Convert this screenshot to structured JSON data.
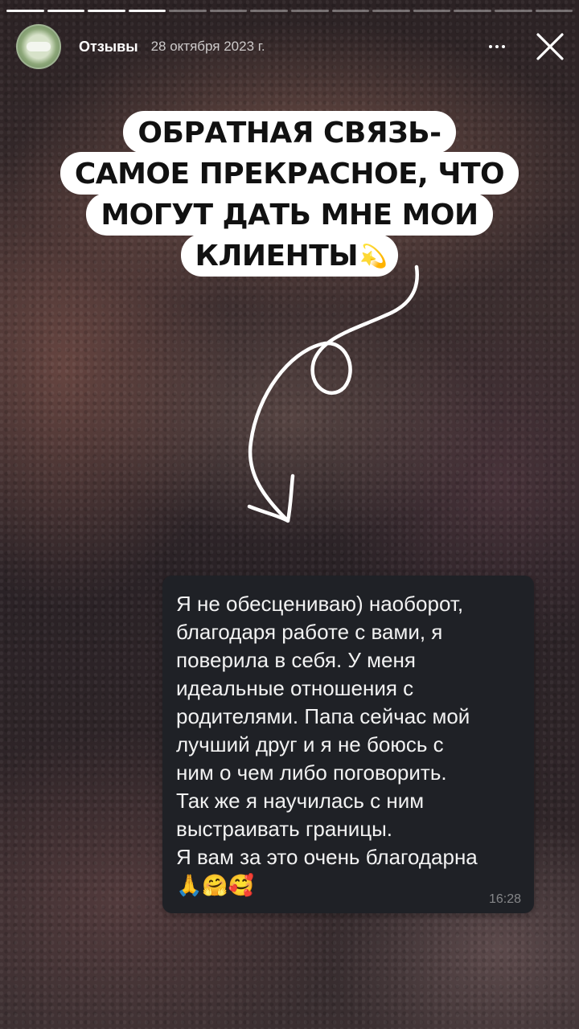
{
  "story": {
    "progress": {
      "segments_total": 14,
      "segments_done": 4
    },
    "header": {
      "account_name": "Отзывы",
      "date": "28 октября 2023 г.",
      "more_icon": "more-dots-icon",
      "close_icon": "close-icon"
    },
    "sticker": {
      "lines": [
        "ОБРАТНАЯ СВЯЗЬ-",
        "САМОЕ ПРЕКРАСНОЕ, ЧТО",
        "МОГУТ ДАТЬ МНЕ МОИ",
        "КЛИЕНТЫ"
      ],
      "emoji": "💫"
    },
    "message": {
      "lines": [
        "Я не обесцениваю) наоборот,",
        "благодаря работе с вами, я",
        "поверила в себя. У меня",
        "идеальные отношения с",
        "родителями. Папа сейчас мой",
        "лучший друг и я не боюсь с",
        "ним о чем либо поговорить.",
        "Так же я научилась с ним",
        "выстраивать границы.",
        "Я вам за это очень благодарна"
      ],
      "emojis": "🙏🤗🥰",
      "time": "16:28"
    },
    "colors": {
      "sticker_bg": "#ffffff",
      "sticker_text": "#111111",
      "bubble_bg": "#1f2126",
      "bubble_text": "#f2f2f2"
    }
  }
}
